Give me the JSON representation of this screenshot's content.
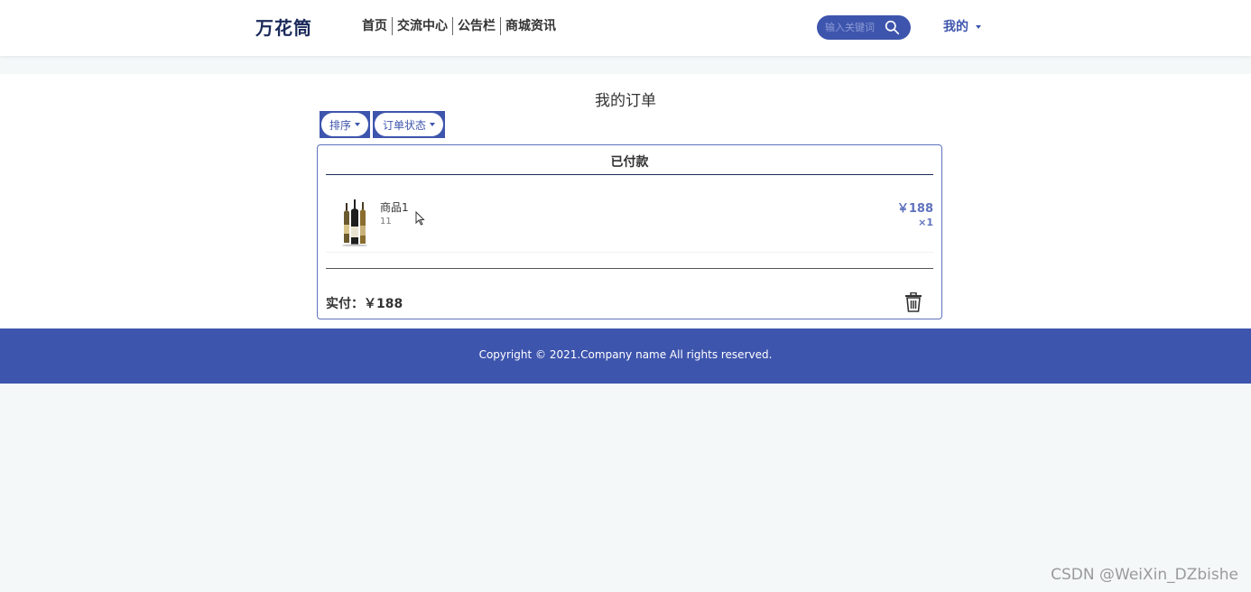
{
  "header": {
    "logo": "万花筒",
    "nav": [
      "首页",
      "交流中心",
      "公告栏",
      "商城资讯"
    ],
    "search": {
      "placeholder": "输入关键词",
      "value": ""
    },
    "user_menu": "我的"
  },
  "main": {
    "title": "我的订单",
    "filters": {
      "sort": "排序",
      "status": "订单状态"
    },
    "order": {
      "status": "已付款",
      "product": {
        "name": "商品1",
        "spec": "11",
        "price": "￥188",
        "quantity": "×1"
      },
      "total": "实付：￥188"
    }
  },
  "footer": {
    "copyright": "Copyright © 2021.Company name All rights reserved."
  },
  "watermark": "CSDN @WeiXin_DZbishe",
  "colors": {
    "primary": "#3e55ad",
    "dark_blue": "#1b2a5a",
    "accent": "#5f72bd",
    "page_bg": "#f4f8f9"
  }
}
